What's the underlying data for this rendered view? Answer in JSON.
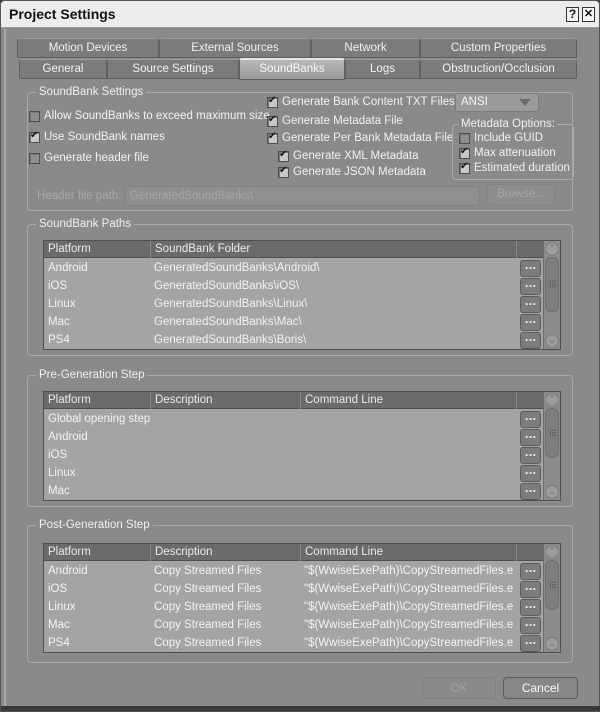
{
  "window": {
    "title": "Project Settings",
    "help_label": "?",
    "close_label": "✕"
  },
  "tabs": {
    "row1": [
      {
        "label": "Motion Devices"
      },
      {
        "label": "External Sources"
      },
      {
        "label": "Network"
      },
      {
        "label": "Custom Properties"
      }
    ],
    "row2": [
      {
        "label": "General"
      },
      {
        "label": "Source Settings"
      },
      {
        "label": "SoundBanks",
        "active": true
      },
      {
        "label": "Logs"
      },
      {
        "label": "Obstruction/Occlusion"
      }
    ]
  },
  "soundbank_settings": {
    "title": "SoundBank Settings",
    "allow_exceed": {
      "label": "Allow SoundBanks to exceed maximum size",
      "checked": false
    },
    "use_names": {
      "label": "Use SoundBank names",
      "checked": true
    },
    "gen_header": {
      "label": "Generate header file",
      "checked": false
    },
    "gen_txt": {
      "label": "Generate Bank Content TXT Files:",
      "checked": true
    },
    "encoding": {
      "value": "ANSI"
    },
    "gen_metadata": {
      "label": "Generate Metadata File",
      "checked": true
    },
    "gen_per_bank": {
      "label": "Generate Per Bank Metadata File",
      "checked": true
    },
    "gen_xml": {
      "label": "Generate XML Metadata",
      "checked": true
    },
    "gen_json": {
      "label": "Generate JSON Metadata",
      "checked": true
    },
    "metadata_options": {
      "title": "Metadata Options:",
      "include_guid": {
        "label": "Include GUID",
        "checked": false
      },
      "max_atten": {
        "label": "Max attenuation",
        "checked": true
      },
      "est_duration": {
        "label": "Estimated duration",
        "checked": true
      }
    },
    "header_path_label": "Header file path:",
    "header_path_value": "GeneratedSoundBanks\\",
    "browse_label": "Browse..."
  },
  "soundbank_paths": {
    "title": "SoundBank Paths",
    "columns": [
      "Platform",
      "SoundBank Folder"
    ],
    "rows": [
      {
        "platform": "Android",
        "folder": "GeneratedSoundBanks\\Android\\"
      },
      {
        "platform": "iOS",
        "folder": "GeneratedSoundBanks\\iOS\\"
      },
      {
        "platform": "Linux",
        "folder": "GeneratedSoundBanks\\Linux\\"
      },
      {
        "platform": "Mac",
        "folder": "GeneratedSoundBanks\\Mac\\"
      },
      {
        "platform": "PS4",
        "folder": "GeneratedSoundBanks\\Boris\\"
      }
    ],
    "ellipsis": "..."
  },
  "pre_generation": {
    "title": "Pre-Generation Step",
    "columns": [
      "Platform",
      "Description",
      "Command Line"
    ],
    "rows": [
      {
        "platform": "Global opening step",
        "description": "",
        "command": ""
      },
      {
        "platform": "Android",
        "description": "",
        "command": ""
      },
      {
        "platform": "iOS",
        "description": "",
        "command": ""
      },
      {
        "platform": "Linux",
        "description": "",
        "command": ""
      },
      {
        "platform": "Mac",
        "description": "",
        "command": ""
      }
    ],
    "ellipsis": "..."
  },
  "post_generation": {
    "title": "Post-Generation Step",
    "columns": [
      "Platform",
      "Description",
      "Command Line"
    ],
    "rows": [
      {
        "platform": "Android",
        "description": "Copy Streamed Files",
        "command": "\"$(WwiseExePath)\\CopyStreamedFiles.e..."
      },
      {
        "platform": "iOS",
        "description": "Copy Streamed Files",
        "command": "\"$(WwiseExePath)\\CopyStreamedFiles.e..."
      },
      {
        "platform": "Linux",
        "description": "Copy Streamed Files",
        "command": "\"$(WwiseExePath)\\CopyStreamedFiles.e..."
      },
      {
        "platform": "Mac",
        "description": "Copy Streamed Files",
        "command": "\"$(WwiseExePath)\\CopyStreamedFiles.e..."
      },
      {
        "platform": "PS4",
        "description": "Copy Streamed Files",
        "command": "\"$(WwiseExePath)\\CopyStreamedFiles.e..."
      }
    ],
    "ellipsis": "..."
  },
  "footer": {
    "ok_label": "OK",
    "cancel_label": "Cancel"
  }
}
